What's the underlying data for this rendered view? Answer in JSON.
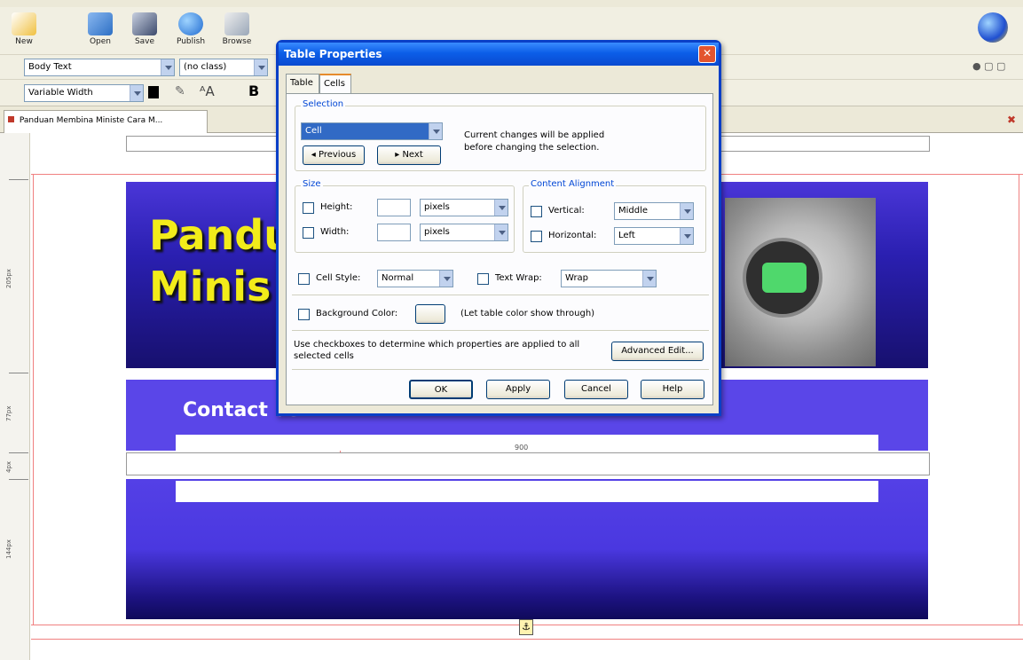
{
  "toolbar": {
    "new_label": "New",
    "open_label": "Open",
    "save_label": "Save",
    "publish_label": "Publish",
    "browse_label": "Browse"
  },
  "format": {
    "paragraph_style": "Body Text",
    "class_style": "(no class)",
    "font": "Variable Width"
  },
  "document_tab": {
    "title": "Panduan Membina Ministe Cara M..."
  },
  "page": {
    "title_line1": "Pandu",
    "title_line2": "Minis",
    "contact_text": "Contact us",
    "mid_label": "900",
    "ruler_labels": [
      "205px",
      "77px",
      "4px",
      "144px"
    ]
  },
  "dialog": {
    "title": "Table Properties",
    "tabs": [
      "Table",
      "Cells"
    ],
    "selection": {
      "group_label": "Selection",
      "value": "Cell",
      "previous_label": "Previous",
      "next_label": "Next",
      "note": "Current changes will be applied before changing the selection."
    },
    "size": {
      "group_label": "Size",
      "height_label": "Height:",
      "width_label": "Width:",
      "height_unit": "pixels",
      "width_unit": "pixels"
    },
    "alignment": {
      "group_label": "Content Alignment",
      "vertical_label": "Vertical:",
      "vertical_value": "Middle",
      "horizontal_label": "Horizontal:",
      "horizontal_value": "Left"
    },
    "cell_style_label": "Cell Style:",
    "cell_style_value": "Normal",
    "text_wrap_label": "Text Wrap:",
    "text_wrap_value": "Wrap",
    "bg_color_label": "Background Color:",
    "bg_color_note": "(Let table color show through)",
    "checkbox_note": "Use checkboxes to determine which properties are applied to all selected cells",
    "advanced_edit_label": "Advanced Edit...",
    "ok_label": "OK",
    "apply_label": "Apply",
    "cancel_label": "Cancel",
    "help_label": "Help"
  },
  "colors": {
    "titlebar": "#0b5ee8",
    "header_band": "#2a1fb0",
    "title_text": "#f2ec1a",
    "contact_band": "#5a46e8"
  }
}
